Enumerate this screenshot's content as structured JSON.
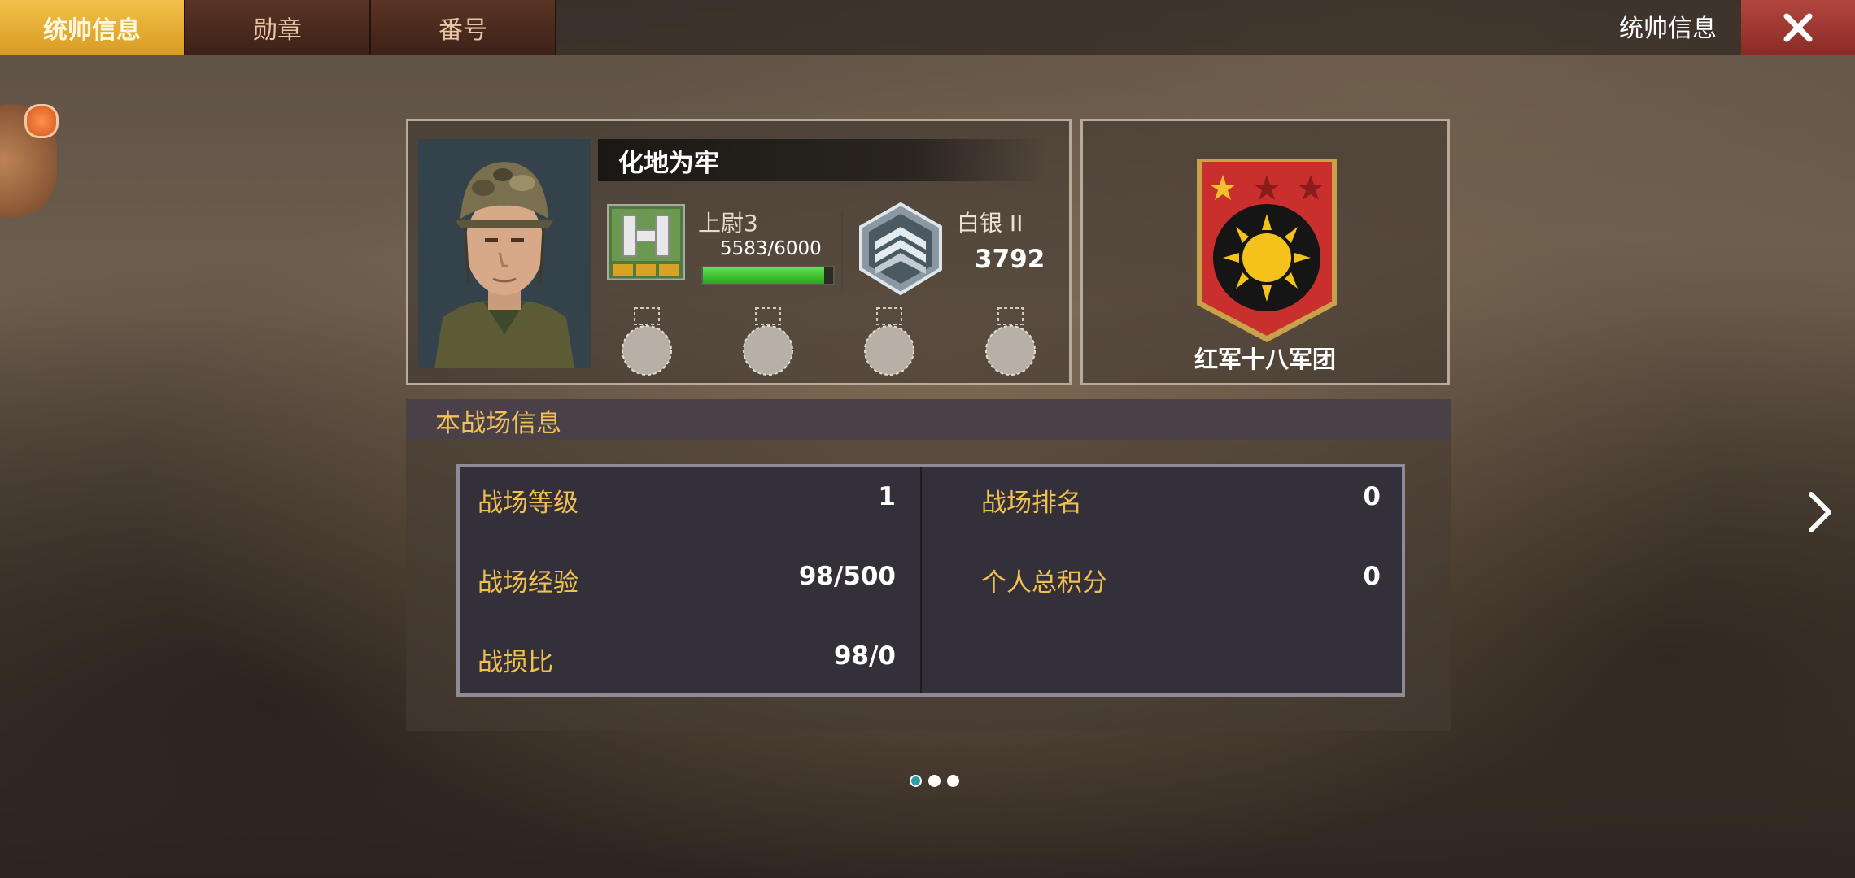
{
  "tabs": [
    {
      "label": "统帅信息",
      "active": true
    },
    {
      "label": "勋章",
      "active": false
    },
    {
      "label": "番号",
      "active": false
    }
  ],
  "header": {
    "title": "统帅信息"
  },
  "player": {
    "name": "化地为牢",
    "rank_name": "上尉3",
    "xp_text": "5583/6000",
    "xp_progress": 0.93,
    "tier_name": "白银 II",
    "tier_score": "3792",
    "medal_slots": 4
  },
  "legion": {
    "name": "红军十八军团",
    "stars_lit": 1,
    "stars_total": 3
  },
  "battlefield": {
    "title": "本战场信息",
    "rows_left": [
      {
        "label": "战场等级",
        "value": "1"
      },
      {
        "label": "战场经验",
        "value": "98/500"
      },
      {
        "label": "战损比",
        "value": "98/0"
      }
    ],
    "rows_right": [
      {
        "label": "战场排名",
        "value": "0"
      },
      {
        "label": "个人总积分",
        "value": "0"
      }
    ]
  },
  "pagination": {
    "pages": 3,
    "current": 1
  },
  "colors": {
    "accent": "#f0bf4e",
    "active_tab": "#e8ae30",
    "close": "#a23a33",
    "xp": "#3fc32d"
  }
}
